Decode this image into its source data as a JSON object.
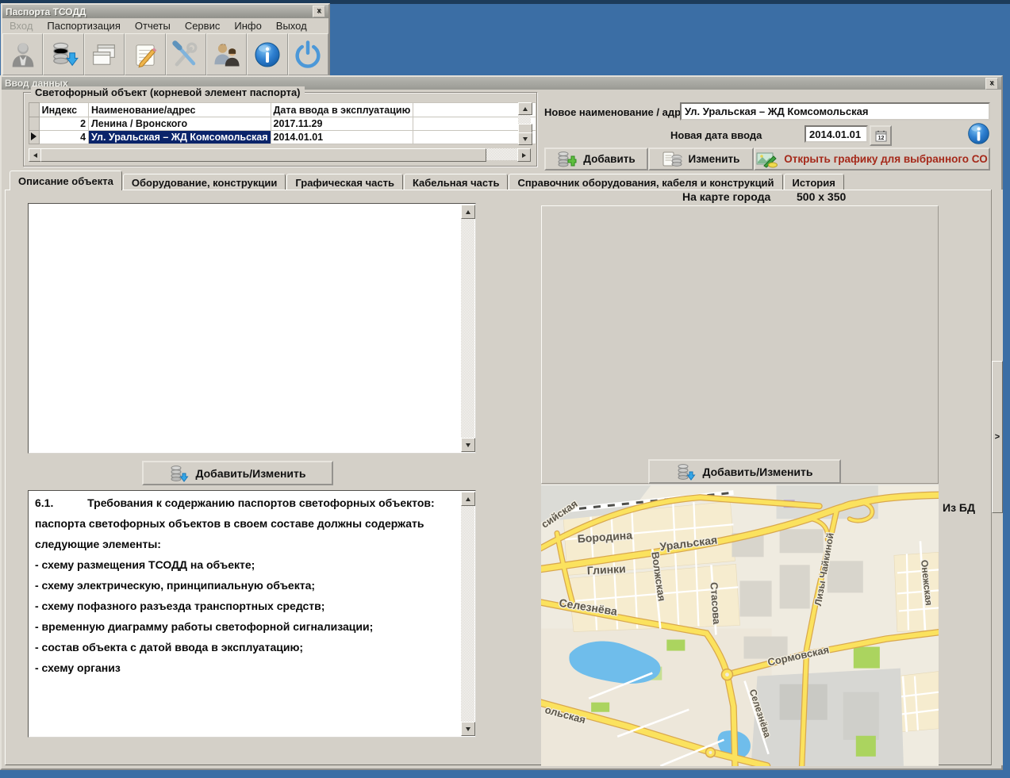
{
  "main_window": {
    "title": "Паспорта ТСОДД",
    "close_label": "x",
    "menu_items": [
      "Вход",
      "Паспортизация",
      "Отчеты",
      "Сервис",
      "Инфо",
      "Выход"
    ],
    "toolbar_icons": [
      "user-icon",
      "database-download-icon",
      "windows-cascade-icon",
      "notepad-pencil-icon",
      "tools-icon",
      "users-icon",
      "info-icon",
      "power-icon"
    ]
  },
  "input_window": {
    "title": "Ввод данных",
    "close_label": "x",
    "traffic_object_group": {
      "label": "Светофорный объект (корневой элемент паспорта)",
      "table": {
        "columns": [
          "Индекс",
          "Наименование/адрес",
          "Дата ввода в эксплуатацию"
        ],
        "rows": [
          {
            "index": "2",
            "name": "Ленина / Вронского",
            "date": "2017.11.29",
            "selected": false
          },
          {
            "index": "4",
            "name": "Ул. Уральская – ЖД Комсомольская",
            "date": "2014.01.01",
            "selected": true
          }
        ]
      }
    },
    "form": {
      "new_name_label": "Новое наименование / адрес",
      "new_name_value": "Ул. Уральская – ЖД Комсомольская",
      "new_date_label": "Новая дата ввода",
      "new_date_value": "2014.01.01",
      "calendar_icon": "calendar-icon",
      "info_icon": "info-icon",
      "add_button": "Добавить",
      "edit_button": "Изменить",
      "open_graphics_button": "Открыть  графику для выбранного СО"
    },
    "tabs": [
      "Описание объекта",
      "Оборудование, конструкции",
      "Графическая часть",
      "Кабельная часть",
      "Справочник  оборудования, кабеля и конструкций",
      "История"
    ],
    "active_tab": "Описание объекта",
    "description_tab": {
      "add_edit_button": "Добавить/Изменить",
      "requirements_text": "6.1.           Требования к содержанию паспортов светофорных объектов: паспорта светофорных объектов в своем составе должны содержать следующие элементы:\n- схему размещения ТСОДД на объекте;\n- схему электрическую, принципиальную объекта;\n- схему пофазного разъезда транспортных средств;\n- временную диаграмму работы светофорной сигнализации;\n- состав объекта с датой ввода в эксплуатацию;\n- схему организ"
    },
    "map_section": {
      "caption": "На карте города",
      "size_label": "500 x 350",
      "add_edit_button": "Добавить/Изменить",
      "from_db_label": "Из БД",
      "street_labels": [
        "сийская",
        "Бородина",
        "Уральская",
        "Глинки",
        "Волжская",
        "Стасова",
        "Селезнёва",
        "Сормовская",
        "Селезнёва",
        "Лизы Чайкиной",
        "Онежская",
        "ольская"
      ]
    },
    "expand_button": ">"
  },
  "colors": {
    "desktop_blue": "#3B6EA5",
    "top_strip_navy": "#1C3B5A",
    "window_gray": "#D4D0C8",
    "selection_navy": "#0A246A",
    "open_graphics_red": "#A5291A",
    "road_yellow": "#FBE25E",
    "water_blue": "#6FBDEB",
    "park_green": "#ABD45F"
  }
}
